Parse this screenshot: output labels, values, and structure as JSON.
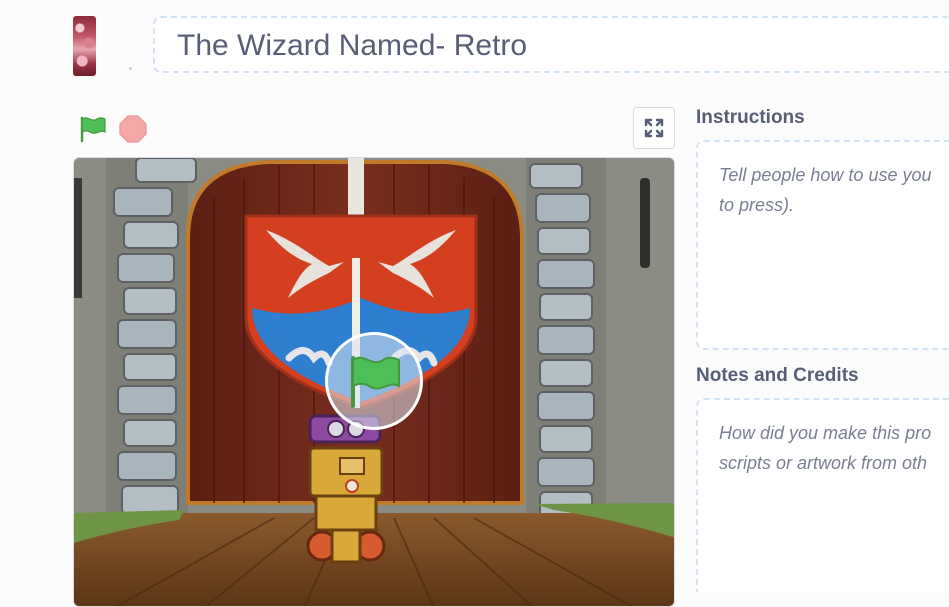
{
  "project": {
    "title": "The Wizard Named- Retro"
  },
  "controls": {
    "green_flag_icon": "green-flag-icon",
    "stop_icon": "stop-sign-icon",
    "fullscreen_icon": "fullscreen-icon"
  },
  "instructions": {
    "heading": "Instructions",
    "placeholder_line1": "Tell people how to use you",
    "placeholder_line2": "to press)."
  },
  "notes": {
    "heading": "Notes and Credits",
    "placeholder_line1": "How did you make this pro",
    "placeholder_line2": "scripts or artwork from oth"
  },
  "colors": {
    "accent_blue": "#d3e3f5",
    "flag_green": "#4cbf56",
    "stop_red": "#ec5959",
    "text": "#575e75"
  }
}
